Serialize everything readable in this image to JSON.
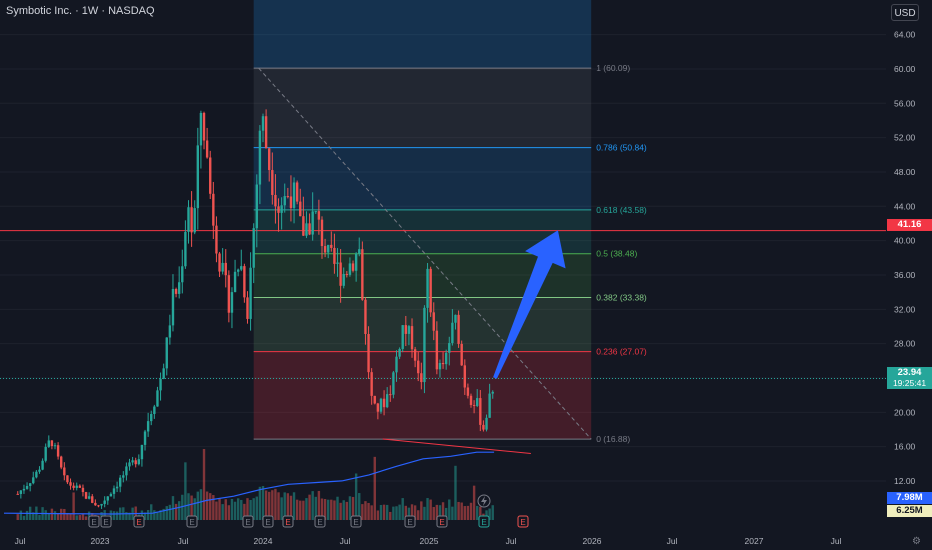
{
  "header": {
    "symbol_title": "Symbotic Inc. · 1W · NASDAQ",
    "currency_button": "USD"
  },
  "price_labels": {
    "alert": "41.16",
    "last": "23.94",
    "countdown": "19:25:41",
    "volume_avg": "7.98M",
    "volume_last": "6.25M"
  },
  "colors": {
    "background": "#131722",
    "up": "#26a69a",
    "down": "#ef5350",
    "volume_ma": "#2962ff",
    "arrow": "#2962ff",
    "alert_line": "#f23645",
    "last_price": "#26a69a"
  },
  "chart_data": {
    "type": "candlestick",
    "y_axis": {
      "ticks": [
        "64.00",
        "60.00",
        "56.00",
        "52.00",
        "48.00",
        "44.00",
        "40.00",
        "36.00",
        "32.00",
        "28.00",
        "24.00",
        "20.00",
        "16.00",
        "12.00"
      ],
      "values": [
        64,
        60,
        56,
        52,
        48,
        44,
        40,
        36,
        32,
        28,
        24,
        20,
        16,
        12
      ],
      "range": [
        8,
        66
      ]
    },
    "x_axis": {
      "ticks": [
        "Jul",
        "2023",
        "Jul",
        "2024",
        "Jul",
        "2025",
        "Jul",
        "2026",
        "Jul",
        "2027",
        "Jul"
      ],
      "range": [
        "2022-05",
        "2027-10"
      ]
    },
    "price_path": [
      [
        "2022-06-01",
        10.5
      ],
      [
        "2022-07-15",
        13
      ],
      [
        "2022-08-15",
        17
      ],
      [
        "2022-09-15",
        12
      ],
      [
        "2022-10-15",
        11
      ],
      [
        "2022-12-01",
        9
      ],
      [
        "2023-01-15",
        12
      ],
      [
        "2023-03-01",
        15
      ],
      [
        "2023-03-20",
        19
      ],
      [
        "2023-04-15",
        23
      ],
      [
        "2023-05-01",
        27
      ],
      [
        "2023-05-15",
        33
      ],
      [
        "2023-06-01",
        35
      ],
      [
        "2023-06-20",
        45
      ],
      [
        "2023-07-01",
        40
      ],
      [
        "2023-07-20",
        56
      ],
      [
        "2023-08-10",
        45
      ],
      [
        "2023-09-01",
        37
      ],
      [
        "2023-09-20",
        33
      ],
      [
        "2023-10-15",
        38
      ],
      [
        "2023-11-01",
        32
      ],
      [
        "2023-11-20",
        45
      ],
      [
        "2023-12-01",
        55
      ],
      [
        "2023-12-20",
        49
      ],
      [
        "2024-01-10",
        44
      ],
      [
        "2024-02-10",
        46
      ],
      [
        "2024-03-01",
        41
      ],
      [
        "2024-04-01",
        43
      ],
      [
        "2024-05-01",
        38
      ],
      [
        "2024-06-01",
        36
      ],
      [
        "2024-07-10",
        39
      ],
      [
        "2024-07-25",
        28
      ],
      [
        "2024-08-10",
        20
      ],
      [
        "2024-09-01",
        21
      ],
      [
        "2024-09-20",
        23
      ],
      [
        "2024-10-15",
        30
      ],
      [
        "2024-11-10",
        28
      ],
      [
        "2024-11-25",
        22
      ],
      [
        "2024-12-10",
        37
      ],
      [
        "2025-01-01",
        25
      ],
      [
        "2025-01-15",
        25
      ],
      [
        "2025-02-01",
        29
      ],
      [
        "2025-02-15",
        31
      ],
      [
        "2025-03-01",
        24
      ],
      [
        "2025-03-15",
        22
      ],
      [
        "2025-04-01",
        21
      ],
      [
        "2025-04-15",
        18
      ],
      [
        "2025-04-28",
        21
      ],
      [
        "2025-05-12",
        23.94
      ]
    ],
    "volume_ma": [
      [
        "2022-05-01",
        0.8
      ],
      [
        "2022-09-01",
        0.75
      ],
      [
        "2023-01-01",
        0.7
      ],
      [
        "2023-04-01",
        0.8
      ],
      [
        "2023-06-01",
        1.5
      ],
      [
        "2023-08-01",
        2.3
      ],
      [
        "2023-10-01",
        2.8
      ],
      [
        "2023-12-01",
        3.6
      ],
      [
        "2024-02-01",
        4.2
      ],
      [
        "2024-04-01",
        4.4
      ],
      [
        "2024-06-01",
        4.6
      ],
      [
        "2024-08-01",
        5.3
      ],
      [
        "2024-10-01",
        6.3
      ],
      [
        "2024-12-01",
        7.2
      ],
      [
        "2025-02-01",
        7.5
      ],
      [
        "2025-04-01",
        7.98
      ],
      [
        "2025-05-10",
        7.98
      ]
    ],
    "fibonacci": {
      "levels": [
        {
          "ratio": "1",
          "value": 60.09,
          "label": "1 (60.09)",
          "color": "#787b86"
        },
        {
          "ratio": "0.786",
          "value": 50.84,
          "label": "0.786 (50.84)",
          "color": "#2196f3"
        },
        {
          "ratio": "0.618",
          "value": 43.58,
          "label": "0.618 (43.58)",
          "color": "#26a69a"
        },
        {
          "ratio": "0.5",
          "value": 38.48,
          "label": "0.5 (38.48)",
          "color": "#4caf50"
        },
        {
          "ratio": "0.382",
          "value": 33.38,
          "label": "0.382 (33.38)",
          "color": "#81c784"
        },
        {
          "ratio": "0.236",
          "value": 27.07,
          "label": "0.236 (27.07)",
          "color": "#f23645"
        },
        {
          "ratio": "0",
          "value": 16.88,
          "label": "0 (16.88)",
          "color": "#787b86"
        }
      ],
      "start": "2023-11-15",
      "end": "2025-12-15"
    },
    "alert_value": 41.16,
    "last_value": 23.94,
    "support_line": [
      [
        "2024-09-01",
        16.9
      ],
      [
        "2025-08-01",
        15.2
      ]
    ],
    "projection_arrow": [
      [
        "2025-05-12",
        24
      ],
      [
        "2025-10-01",
        41.2
      ]
    ],
    "earnings_markers": [
      "E",
      "E",
      "E",
      "E",
      "E",
      "E",
      "E",
      "E",
      "E",
      "E",
      "E",
      "E"
    ],
    "future_earnings_marker": "E"
  }
}
